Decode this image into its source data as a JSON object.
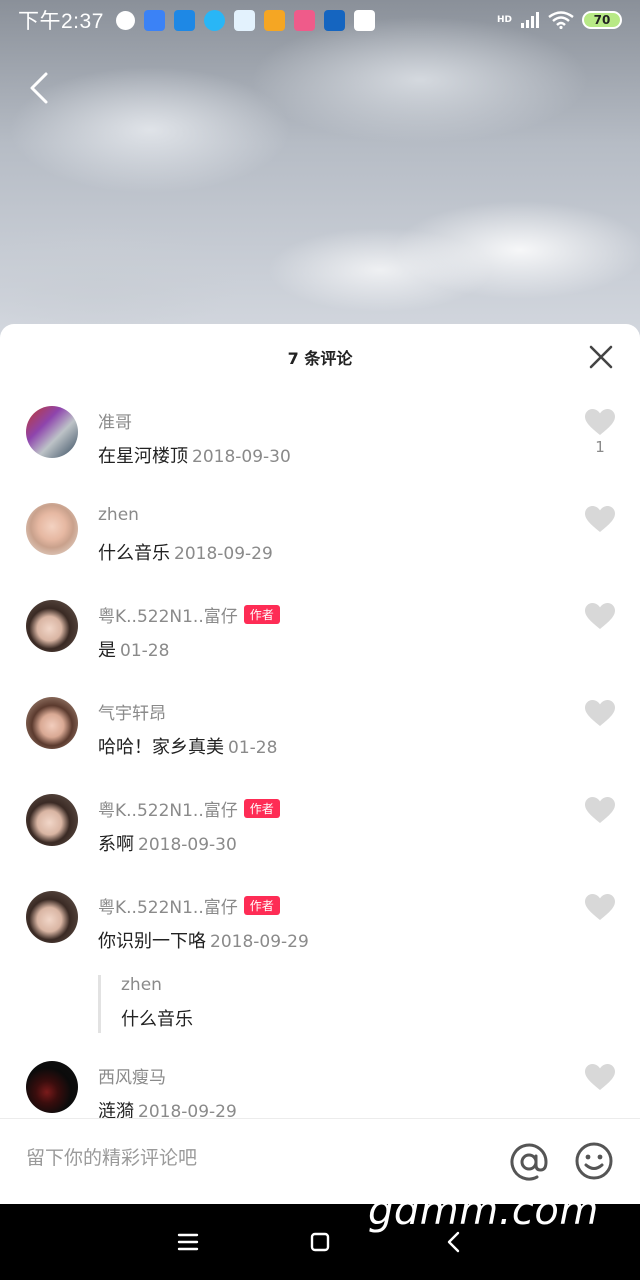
{
  "status_bar": {
    "time": "下午2:37",
    "network_label": "HD",
    "battery": "70"
  },
  "sheet": {
    "title": "7 条评论"
  },
  "comments": [
    {
      "name": "准哥",
      "text": "在星河楼顶",
      "date": "2018-09-30",
      "likes": "1",
      "author": false
    },
    {
      "name": "zhen",
      "text": "什么音乐",
      "date": "2018-09-29",
      "likes": "",
      "author": false
    },
    {
      "name": "粤K..522N1..富仔",
      "text": "是",
      "date": "01-28",
      "likes": "",
      "author": true
    },
    {
      "name": "气宇轩昂",
      "text": "哈哈！家乡真美",
      "date": "01-28",
      "likes": "",
      "author": false
    },
    {
      "name": "粤K..522N1..富仔",
      "text": "系啊",
      "date": "2018-09-30",
      "likes": "",
      "author": true
    },
    {
      "name": "粤K..522N1..富仔",
      "text": "你识别一下咯",
      "date": "2018-09-29",
      "likes": "",
      "author": true,
      "reply": {
        "name": "zhen",
        "text": "什么音乐"
      }
    },
    {
      "name": "西风瘦马",
      "text": "涟漪",
      "date": "2018-09-29",
      "likes": "",
      "author": false
    }
  ],
  "author_tag": "作者",
  "input": {
    "placeholder": "留下你的精彩评论吧"
  },
  "watermark": "gdmm.com",
  "colors": {
    "accent": "#fe2c55",
    "text_primary": "#222222",
    "text_secondary": "#8a8a8a",
    "icon_gray": "#d8d8d8"
  },
  "icons": {
    "back": "chevron-left-icon",
    "close": "close-icon",
    "like": "heart-icon",
    "mention": "at-icon",
    "emoji": "smile-icon"
  }
}
